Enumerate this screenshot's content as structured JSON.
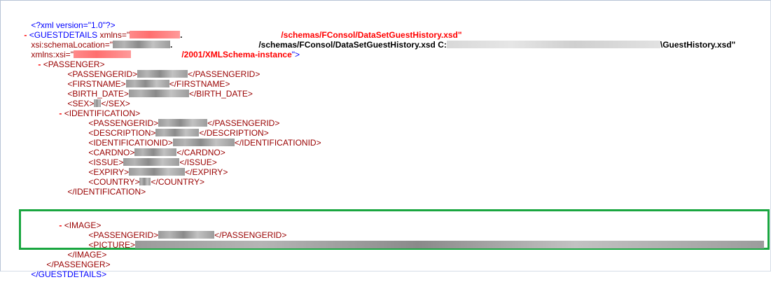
{
  "xml": {
    "declaration": "<?xml version=\"1.0\"?>",
    "toggle": "-",
    "root_open": "<GUESTDETAILS",
    "xmlns_attr": " xmlns=\"",
    "xmlns_tail": ".",
    "xmlns_url": "/schemas/FConsol/DataSetGuestHistory.xsd\"",
    "schemaloc_attr": "xsi:schemaLocation=\"",
    "schemaloc_mid": ".",
    "schemaloc_path": "/schemas/FConsol/DataSetGuestHistory.xsd C:",
    "schemaloc_file": "\\GuestHistory.xsd\"",
    "xsi_attr": "xmlns:xsi=\"",
    "xsi_url": "/2001/XMLSchema-instance",
    "xsi_close": "\">",
    "passenger_open": "<PASSENGER>",
    "passengerid_open": "<PASSENGERID>",
    "passengerid_close": "</PASSENGERID>",
    "firstname_open": "<FIRSTNAME>",
    "firstname_close": "</FIRSTNAME>",
    "birth_open": "<BIRTH_DATE>",
    "birth_close": "</BIRTH_DATE>",
    "sex_open": "<SEX>",
    "sex_close": "</SEX>",
    "identification_open": "<IDENTIFICATION>",
    "description_open": "<DESCRIPTION>",
    "description_close": "</DESCRIPTION>",
    "identificationid_open": "<IDENTIFICATIONID>",
    "identificationid_close": "</IDENTIFICATIONID>",
    "cardno_open": "<CARDNO>",
    "cardno_close": "</CARDNO>",
    "issue_open": "<ISSUE>",
    "issue_close": "</ISSUE>",
    "expiry_open": "<EXPIRY>",
    "expiry_close": "</EXPIRY>",
    "country_open": "<COUNTRY>",
    "country_close": "</COUNTRY>",
    "identification_close": "</IDENTIFICATION>",
    "image_open": "<IMAGE>",
    "picture_open": "<PICTURE>",
    "image_close": "</IMAGE>",
    "passenger_close": "</PASSENGER>",
    "root_close": "</GUESTDETAILS>"
  },
  "colors": {
    "markup": "#0000ff",
    "element": "#990000",
    "attribute_value": "#ff0000",
    "highlight": "#19a640"
  }
}
